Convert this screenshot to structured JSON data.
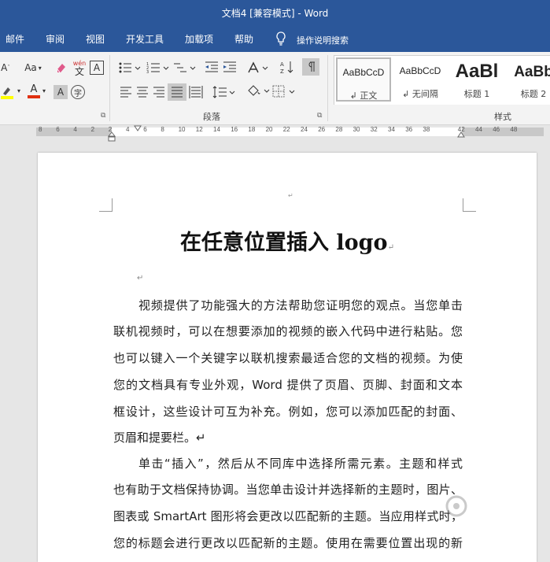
{
  "window": {
    "title": "文档4 [兼容模式] - Word"
  },
  "menu": {
    "items": [
      "邮件",
      "审阅",
      "视图",
      "开发工具",
      "加载项",
      "帮助"
    ],
    "tell_me": "操作说明搜索"
  },
  "ribbon": {
    "font_group": {
      "aa_label": "Aa",
      "wen_label": "wén",
      "wen_char": "文",
      "a_box_label": "A",
      "a_label": "A",
      "circle_char": "字"
    },
    "paragraph_group": {
      "label": "段落"
    },
    "styles_group": {
      "label": "样式",
      "tiles": [
        {
          "sample": "AaBbCcD",
          "name": "↲ 正文"
        },
        {
          "sample": "AaBbCcD",
          "name": "↲ 无间隔"
        },
        {
          "sample": "AaBl",
          "name": "标题 1"
        },
        {
          "sample": "AaBb",
          "name": "标题 2"
        }
      ]
    }
  },
  "ruler": {
    "ticks": [
      "8",
      "6",
      "4",
      "2",
      "2",
      "4",
      "6",
      "8",
      "10",
      "12",
      "14",
      "16",
      "18",
      "20",
      "22",
      "24",
      "26",
      "28",
      "30",
      "32",
      "34",
      "36",
      "38",
      "42",
      "44",
      "46",
      "48"
    ]
  },
  "document": {
    "title": "在任意位置插入 logo",
    "para_mark": "↵",
    "lines": [
      "视频提供了功能强大的方法帮助您证明您的观点。当您单击",
      "联机视频时，可以在想要添加的视频的嵌入代码中进行粘贴。您",
      "也可以键入一个关键字以联机搜索最适合您的文档的视频。为使",
      "您的文档具有专业外观，Word 提供了页眉、页脚、封面和文本",
      "框设计，这些设计可互为补充。例如，您可以添加匹配的封面、",
      "页眉和提要栏。↵",
      "单击“插入”，然后从不同库中选择所需元素。主题和样式",
      "也有助于文档保持协调。当您单击设计并选择新的主题时，图片、",
      "图表或 SmartArt 图形将会更改以匹配新的主题。当应用样式时，",
      "您的标题会进行更改以匹配新的主题。使用在需要位置出现的新"
    ]
  },
  "colors": {
    "title_bar": "#2b579a",
    "ribbon_bg": "#f3f3f3",
    "highlight_yellow": "#ffff00",
    "font_color_red": "#e03010"
  }
}
